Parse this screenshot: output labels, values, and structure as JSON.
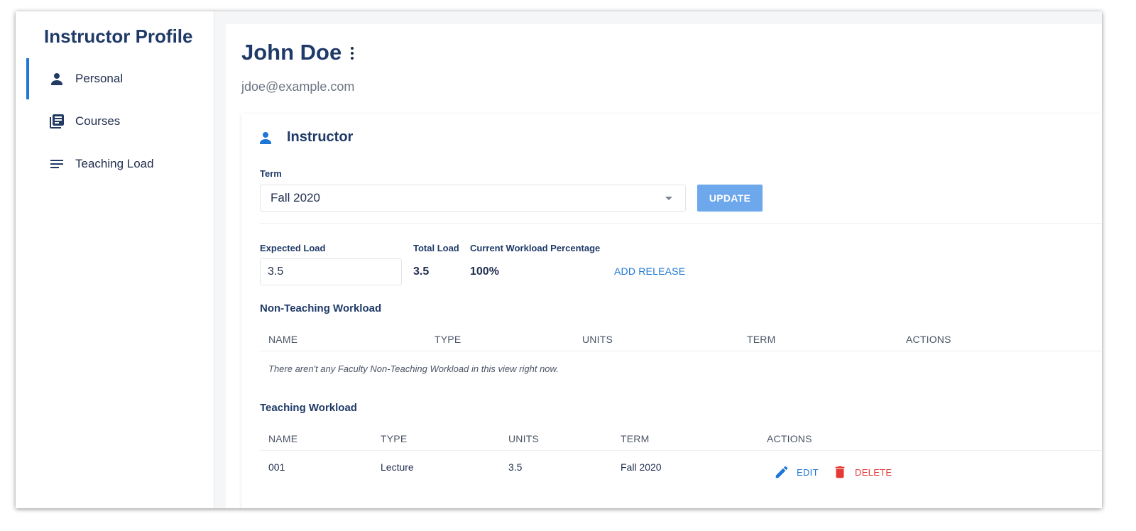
{
  "sidebar": {
    "title": "Instructor Profile",
    "items": [
      {
        "label": "Personal",
        "icon": "person-icon",
        "active": true
      },
      {
        "label": "Courses",
        "icon": "library-books-icon",
        "active": false
      },
      {
        "label": "Teaching Load",
        "icon": "list-lines-icon",
        "active": false
      }
    ]
  },
  "profile": {
    "name": "John Doe",
    "email": "jdoe@example.com"
  },
  "card": {
    "title": "Instructor",
    "term_label": "Term",
    "term_value": "Fall 2020",
    "update_label": "UPDATE",
    "expected_load_label": "Expected Load",
    "expected_load_value": "3.5",
    "total_load_label": "Total Load",
    "total_load_value": "3.5",
    "workload_pct_label": "Current Workload Percentage",
    "workload_pct_value": "100%",
    "add_release_label": "ADD RELEASE"
  },
  "non_teaching": {
    "title": "Non-Teaching Workload",
    "columns": [
      "NAME",
      "TYPE",
      "UNITS",
      "TERM",
      "ACTIONS"
    ],
    "empty_message": "There aren't any Faculty Non-Teaching Workload in this view right now."
  },
  "teaching": {
    "title": "Teaching Workload",
    "columns": [
      "NAME",
      "TYPE",
      "UNITS",
      "TERM",
      "ACTIONS"
    ],
    "rows": [
      {
        "name": "001",
        "type": "Lecture",
        "units": "3.5",
        "term": "Fall 2020",
        "edit_label": "EDIT",
        "delete_label": "DELETE"
      }
    ]
  },
  "colors": {
    "accent": "#1e77d6",
    "update_button": "#6ea8ec",
    "delete": "#e53935",
    "heading": "#1f3a68"
  }
}
